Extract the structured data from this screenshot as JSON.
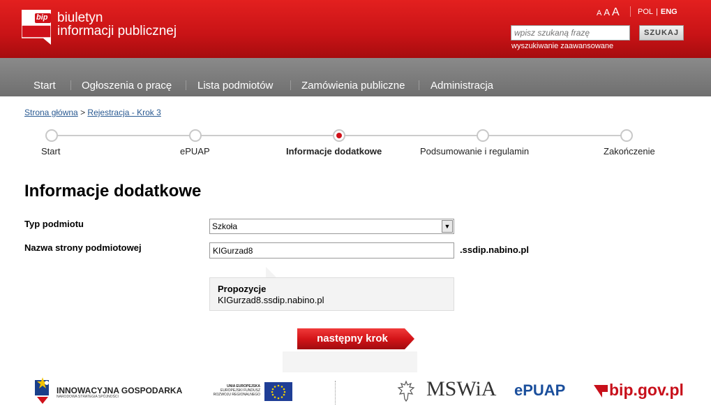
{
  "header": {
    "logo_line1": "biuletyn",
    "logo_line2": "informacji publicznej",
    "logo_badge": "bip",
    "font_sizes": [
      "A",
      "A",
      "A"
    ],
    "languages": [
      "POL",
      "ENG"
    ],
    "active_language": "ENG",
    "search_placeholder": "wpisz szukaną frazę",
    "search_button": "SZUKAJ",
    "advanced_search": "wyszukiwanie zaawansowane",
    "brand_color": "#c81316"
  },
  "nav": {
    "items": [
      "Start",
      "Ogłoszenia o pracę",
      "Lista podmiotów",
      "Zamówienia publiczne",
      "Administracja"
    ]
  },
  "breadcrumb": {
    "home": "Strona główna",
    "separator": ">",
    "current": "Rejestracja - Krok 3"
  },
  "steps": {
    "items": [
      "Start",
      "ePUAP",
      "Informacje dodatkowe",
      "Podsumowanie i regulamin",
      "Zakończenie"
    ],
    "active_index": 2
  },
  "form": {
    "title": "Informacje dodatkowe",
    "type_label": "Typ podmiotu",
    "type_value": "Szkoła",
    "name_label": "Nazwa strony podmiotowej",
    "name_value": "KIGurzad8",
    "domain_suffix": ".ssdip.nabino.pl",
    "suggestions_title": "Propozycje",
    "suggestion": "KIGurzad8.ssdip.nabino.pl",
    "next_button": "następny krok"
  },
  "footer": {
    "innovation_title": "INNOWACYJNA GOSPODARKA",
    "innovation_sub": "NARODOWA STRATEGIA SPÓJNOŚCI",
    "eu_line1": "UNIA EUROPEJSKA",
    "eu_line2": "EUROPEJSKI FUNDUSZ",
    "eu_line3": "ROZWOJU REGIONALNEGO",
    "mswia": "MSWiA",
    "epuap": "ePUAP",
    "bip_gov": "bip.gov.pl"
  }
}
